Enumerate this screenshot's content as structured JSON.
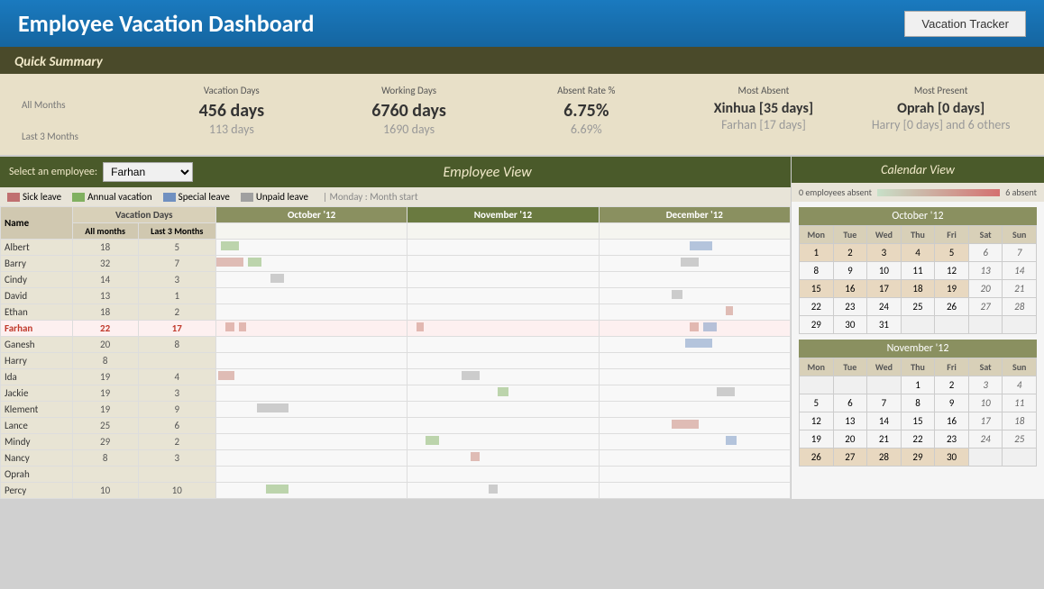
{
  "header": {
    "title": "Employee Vacation Dashboard",
    "vacation_tracker_label": "Vacation Tracker"
  },
  "quick_summary": {
    "title": "Quick Summary",
    "columns": {
      "vacation_days": "Vacation Days",
      "working_days": "Working Days",
      "absent_rate": "Absent Rate %",
      "most_absent": "Most Absent",
      "most_present": "Most Present"
    },
    "rows": {
      "all_months": {
        "label": "All Months",
        "vacation_days": "456 days",
        "working_days": "6760 days",
        "absent_rate": "6.75%",
        "most_absent": "Xinhua [35 days]",
        "most_present": "Oprah [0 days]"
      },
      "last_3_months": {
        "label": "Last 3 Months",
        "vacation_days": "113 days",
        "working_days": "1690 days",
        "absent_rate": "6.69%",
        "most_absent": "Farhan [17 days]",
        "most_present": "Harry [0 days] and 6 others"
      }
    }
  },
  "employee_view": {
    "select_label": "Select an employee:",
    "selected_employee": "Farhan",
    "title": "Employee View",
    "legend": {
      "sick_leave": "Sick leave",
      "annual_vacation": "Annual vacation",
      "special_leave": "Special leave",
      "unpaid_leave": "Unpaid leave",
      "month_start": "| Monday : Month start"
    },
    "table_headers": {
      "name": "Name",
      "all_months": "All months",
      "last_3_months": "Last 3 Months",
      "vacation_days": "Vacation Days",
      "oct_12": "October '12",
      "nov_12": "November '12",
      "dec_12": "December '12"
    },
    "employees": [
      {
        "name": "Albert",
        "all_months": 18,
        "last_3": 5,
        "highlight": false
      },
      {
        "name": "Barry",
        "all_months": 32,
        "last_3": 7,
        "highlight": false
      },
      {
        "name": "Cindy",
        "all_months": 14,
        "last_3": 3,
        "highlight": false
      },
      {
        "name": "David",
        "all_months": 13,
        "last_3": 1,
        "highlight": false
      },
      {
        "name": "Ethan",
        "all_months": 18,
        "last_3": 2,
        "highlight": false
      },
      {
        "name": "Farhan",
        "all_months": 22,
        "last_3": 17,
        "highlight": true
      },
      {
        "name": "Ganesh",
        "all_months": 20,
        "last_3": 8,
        "highlight": false
      },
      {
        "name": "Harry",
        "all_months": 8,
        "last_3": "",
        "highlight": false
      },
      {
        "name": "Ida",
        "all_months": 19,
        "last_3": 4,
        "highlight": false
      },
      {
        "name": "Jackie",
        "all_months": 19,
        "last_3": 3,
        "highlight": false
      },
      {
        "name": "Klement",
        "all_months": 19,
        "last_3": 9,
        "highlight": false
      },
      {
        "name": "Lance",
        "all_months": 25,
        "last_3": 6,
        "highlight": false
      },
      {
        "name": "Mindy",
        "all_months": 29,
        "last_3": 2,
        "highlight": false
      },
      {
        "name": "Nancy",
        "all_months": 8,
        "last_3": 3,
        "highlight": false
      },
      {
        "name": "Oprah",
        "all_months": "",
        "last_3": "",
        "highlight": false
      },
      {
        "name": "Percy",
        "all_months": 10,
        "last_3": 10,
        "highlight": false
      }
    ]
  },
  "calendar_view": {
    "title": "Calendar View",
    "absence_bar": {
      "left": "0 employees absent",
      "right": "6 absent"
    },
    "october": {
      "title": "October '12",
      "headers": [
        "Mon",
        "Tue",
        "Wed",
        "Thu",
        "Fri",
        "Sat",
        "Sun"
      ],
      "weeks": [
        [
          "1",
          "2",
          "3",
          "4",
          "5",
          "6",
          "7"
        ],
        [
          "8",
          "9",
          "10",
          "11",
          "12",
          "13",
          "14"
        ],
        [
          "15",
          "16",
          "17",
          "18",
          "19",
          "20",
          "21"
        ],
        [
          "22",
          "23",
          "24",
          "25",
          "26",
          "27",
          "28"
        ],
        [
          "29",
          "30",
          "31",
          "",
          "",
          "",
          ""
        ]
      ],
      "weekends": [
        "6",
        "7",
        "13",
        "14",
        "20",
        "21",
        "27",
        "28"
      ],
      "highlights": [
        "1",
        "2",
        "3",
        "4",
        "5",
        "15",
        "16",
        "17",
        "18",
        "19"
      ]
    },
    "november": {
      "title": "November '12",
      "headers": [
        "Mon",
        "Tue",
        "Wed",
        "Thu",
        "Fri",
        "Sat",
        "Sun"
      ],
      "weeks": [
        [
          "",
          "",
          "",
          "1",
          "2",
          "3",
          "4"
        ],
        [
          "5",
          "6",
          "7",
          "8",
          "9",
          "10",
          "11"
        ],
        [
          "12",
          "13",
          "14",
          "15",
          "16",
          "17",
          "18"
        ],
        [
          "19",
          "20",
          "21",
          "22",
          "23",
          "24",
          "25"
        ],
        [
          "26",
          "27",
          "28",
          "29",
          "30",
          "",
          ""
        ]
      ],
      "weekends": [
        "3",
        "4",
        "10",
        "11",
        "17",
        "18",
        "24",
        "25"
      ],
      "highlights": [
        "26",
        "27",
        "28",
        "29",
        "30"
      ]
    }
  }
}
